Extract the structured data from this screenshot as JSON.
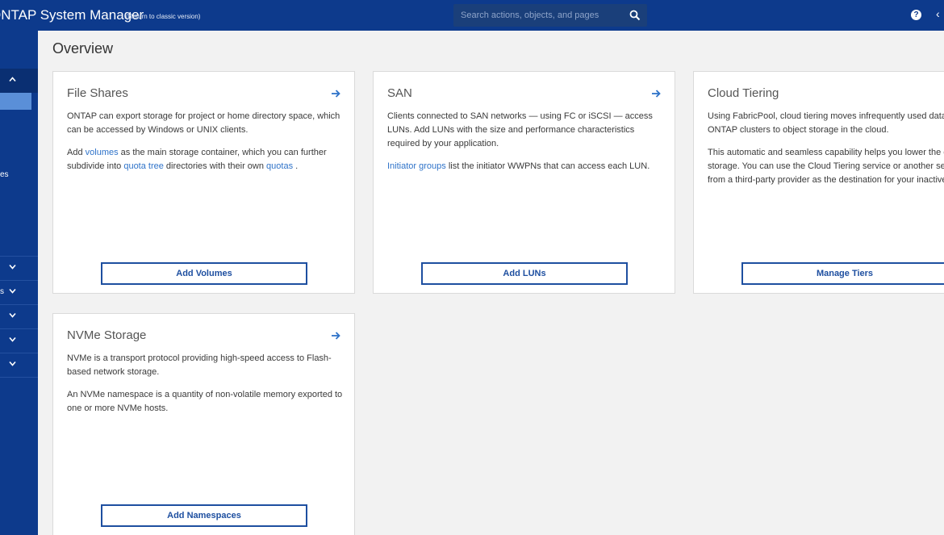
{
  "header": {
    "app_title": "ONTAP System Manager",
    "classic_link": "(Return to classic version)",
    "search_placeholder": "Search actions, objects, and pages",
    "help_icon": "?"
  },
  "sidebar": {
    "partial_labels": [
      "es",
      "s"
    ]
  },
  "page": {
    "title": "Overview"
  },
  "cards": {
    "file_shares": {
      "title": "File Shares",
      "p1": "ONTAP can export storage for project or home directory space, which can be accessed by Windows or UNIX clients.",
      "p2_a": "Add ",
      "p2_link1": "volumes",
      "p2_b": " as the main storage container, which you can further subdivide into ",
      "p2_link2": "quota tree",
      "p2_c": " directories with their own ",
      "p2_link3": "quotas",
      "p2_d": " .",
      "button": "Add Volumes"
    },
    "san": {
      "title": "SAN",
      "p1": "Clients connected to SAN networks — using FC or iSCSI — access LUNs. Add LUNs with the size and performance characteristics required by your application.",
      "p2_link": "Initiator groups",
      "p2_rest": " list the initiator WWPNs that can access each LUN.",
      "button": "Add LUNs"
    },
    "cloud_tiering": {
      "title": "Cloud Tiering",
      "p1": "Using FabricPool, cloud tiering moves infrequently used data from ONTAP clusters to object storage in the cloud.",
      "p2": "This automatic and seamless capability helps you lower the cost of storage.  You can use the Cloud Tiering service or another service from a third-party provider as the destination for your inactive data.",
      "button": "Manage Tiers"
    },
    "nvme": {
      "title": "NVMe Storage",
      "p1": "NVMe is a transport protocol providing high-speed access to Flash-based network storage.",
      "p2": "An NVMe namespace is a quantity of non-volatile memory exported to one or more NVMe hosts.",
      "button": "Add Namespaces"
    }
  },
  "colors": {
    "header_bg": "#0d3a8c",
    "sidebar_highlight": "#5a8fd8",
    "link": "#2f73c9",
    "button_border": "#1e4fa0"
  }
}
